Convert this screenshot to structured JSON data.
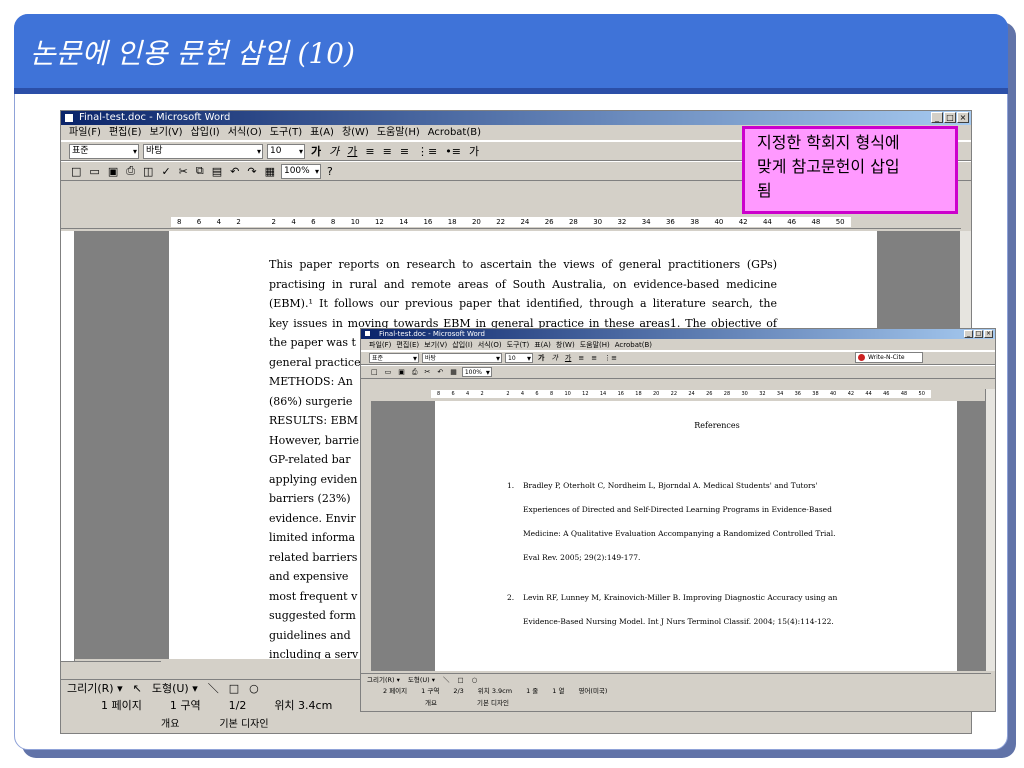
{
  "slide": {
    "title": "논문에 인용 문헌 삽입 (10)"
  },
  "annotation": {
    "lines": [
      "지정한 학회지 형식에",
      "맞게 참고문헌이 삽입",
      "됨"
    ]
  },
  "word_main": {
    "window_title": "Final-test.doc - Microsoft Word",
    "menu": [
      "파일(F)",
      "편집(E)",
      "보기(V)",
      "삽입(I)",
      "서식(O)",
      "도구(T)",
      "표(A)",
      "창(W)",
      "도움말(H)",
      "Acrobat(B)"
    ],
    "style_value": "표준",
    "font_value": "바탕",
    "size_value": "10",
    "zoom_value": "100%",
    "ruler_ticks": [
      "8",
      "6",
      "4",
      "2",
      "",
      "2",
      "4",
      "6",
      "8",
      "10",
      "12",
      "14",
      "16",
      "18",
      "20",
      "22",
      "24",
      "26",
      "28",
      "30",
      "32",
      "34",
      "36",
      "38",
      "40",
      "42",
      "44",
      "46",
      "48",
      "50"
    ],
    "paper_lines": [
      "This paper reports on research to ascertain the views of general practitioners (GPs)",
      "practising in rural and remote areas of South Australia, on evidence-based medicine",
      "(EBM).¹ It follows our previous paper that identified, through a literature search, the",
      "key issues in moving towards EBM in general practice in these areas1. The objective of",
      "the paper was t",
      "general practice",
      "METHODS: An",
      "(86%) surgerie",
      "RESULTS: EBM",
      "However, barrie",
      "GP-related bar",
      "applying eviden",
      "barriers (23%)",
      "evidence. Envir",
      "limited informa",
      "related barriers",
      "and expensive",
      "most frequent v",
      "suggested form",
      "guidelines and",
      "including a serv"
    ],
    "drawing_label": "그리기(R) ▾",
    "autoshape_label": "도형(U) ▾",
    "status": {
      "page": "1 페이지",
      "section": "1 구역",
      "pages": "1/2",
      "position": "위치 3.4cm",
      "tab1": "개요",
      "tab2": "기본 디자인"
    }
  },
  "word_overlay": {
    "window_title": "Final-test.doc - Microsoft Word",
    "menu": [
      "파일(F)",
      "편집(E)",
      "보기(V)",
      "삽입(I)",
      "서식(O)",
      "도구(T)",
      "표(A)",
      "창(W)",
      "도움말(H)",
      "Acrobat(B)"
    ],
    "style_value": "표준",
    "font_value": "바탕",
    "size_value": "10",
    "zoom_value": "100%",
    "write_n_cite": "Write-N-Cite",
    "ruler_ticks": [
      "8",
      "6",
      "4",
      "2",
      "",
      "2",
      "4",
      "6",
      "8",
      "10",
      "12",
      "14",
      "16",
      "18",
      "20",
      "22",
      "24",
      "26",
      "28",
      "30",
      "32",
      "34",
      "36",
      "38",
      "40",
      "42",
      "44",
      "46",
      "48",
      "50"
    ],
    "refs_title": "References",
    "refs": [
      {
        "num": "1.",
        "lines": [
          "Bradley P, Oterholt C, Nordheim L, Bjorndal A. Medical Students' and Tutors'",
          "Experiences of Directed and Self-Directed Learning Programs in Evidence-Based",
          "Medicine: A Qualitative Evaluation Accompanying a Randomized Controlled Trial.",
          "Eval Rev. 2005; 29(2):149-177."
        ]
      },
      {
        "num": "2.",
        "lines": [
          "Levin RF, Lunney M, Krainovich-Miller B. Improving Diagnostic Accuracy using an",
          "Evidence-Based Nursing Model. Int J Nurs Terminol Classif. 2004; 15(4):114-122."
        ]
      }
    ],
    "drawing_label": "그리기(R) ▾",
    "autoshape_label": "도형(U) ▾",
    "status": {
      "page": "2 페이지",
      "section": "1 구역",
      "pages": "2/3",
      "position": "위치 3.9cm",
      "line": "1 줄",
      "col": "1 열",
      "lang": "영어(미국)",
      "tab1": "개요",
      "tab2": "기본 디자인"
    }
  }
}
